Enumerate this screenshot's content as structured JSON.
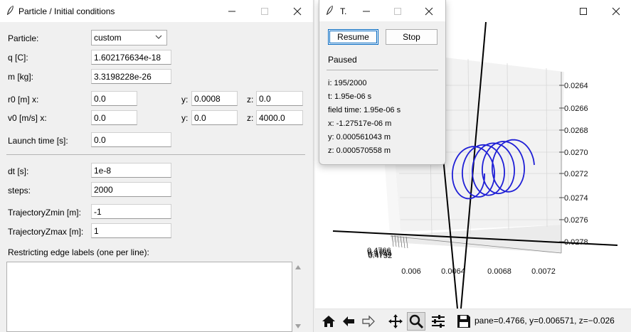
{
  "form_window": {
    "title": "Particle / Initial conditions",
    "particle_label": "Particle:",
    "particle_value": "custom",
    "q_label": "q [C]:",
    "q_value": "1.602176634e-18",
    "m_label": "m [kg]:",
    "m_value": "3.3198228e-26",
    "r0_label": "r0 [m]  x:",
    "r0_x": "0.0",
    "y_label": "y:",
    "z_label": "z:",
    "r0_y": "0.0008",
    "r0_z": "0.0",
    "v0_label": "v0 [m/s] x:",
    "v0_x": "0.0",
    "v0_y": "0.0",
    "v0_z": "4000.0",
    "launch_label": "Launch time [s]:",
    "launch_value": "0.0",
    "dt_label": "dt [s]:",
    "dt_value": "1e-8",
    "steps_label": "steps:",
    "steps_value": "2000",
    "zmin_label": "TrajectoryZmin [m]:",
    "zmin_value": "-1",
    "zmax_label": "TrajectoryZmax [m]:",
    "zmax_value": "1",
    "edges_label": "Restricting edge labels (one per line):",
    "edges_value": ""
  },
  "control_window": {
    "title": "T.",
    "resume_label": "Resume",
    "stop_label": "Stop",
    "state": "Paused",
    "info": [
      "i: 195/2000",
      "t: 1.95e-06 s",
      "field time: 1.95e-06 s",
      "x: -1.27517e-06 m",
      "y: 0.000561043 m",
      "z: 0.000570558 m"
    ]
  },
  "plot_window": {
    "right_axis_ticks": [
      "0.0264",
      "0.0266",
      "0.0268",
      "0.0270",
      "0.0272",
      "0.0274",
      "0.0276",
      "0.0278"
    ],
    "bottom_axis_ticks": [
      "0.006",
      "0.0064",
      "0.0068",
      "0.0072"
    ],
    "left_cluster_ticks": [
      "0.4766",
      "0.4755",
      "0.4744",
      "0.4732"
    ],
    "status": "pane=0.4766, y=0.006571, z=−0.026",
    "trajectory_color": "#1f1fd6",
    "toolbar_icons": [
      "home-icon",
      "back-icon",
      "forward-icon",
      "pan-icon",
      "zoom-icon",
      "subplots-icon",
      "save-icon"
    ]
  }
}
